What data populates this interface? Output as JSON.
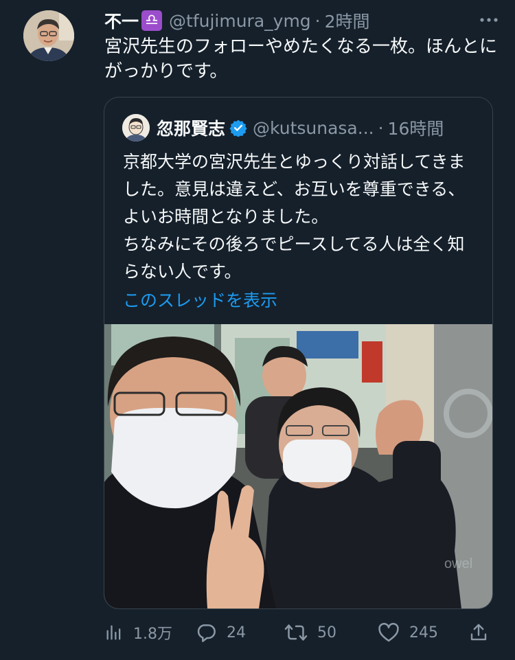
{
  "tweet": {
    "display_name": "不一",
    "zodiac_emoji": "♎",
    "handle": "@tfujimura_ymg",
    "separator": "·",
    "time": "2時間",
    "text": "宮沢先生のフォローやめたくなる一枚。ほんとにがっかりです。"
  },
  "quoted": {
    "display_name": "忽那賢志",
    "handle": "@kutsunasa...",
    "separator": "·",
    "time": "16時間",
    "text": "京都大学の宮沢先生とゆっくり対話してきました。意見は違えど、お互いを尊重できる、よいお時間となりました。\nちなみにその後ろでピースしてる人は全く知らない人です。",
    "show_thread": "このスレッドを表示"
  },
  "actions": {
    "views": "1.8万",
    "replies": "24",
    "retweets": "50",
    "likes": "245"
  },
  "colors": {
    "background": "#15202b",
    "text": "#f7f9f9",
    "secondary": "#8b98a5",
    "link": "#1d9bf0",
    "border": "#38444d"
  },
  "icons": [
    "more-icon",
    "verified-icon",
    "views-icon",
    "reply-icon",
    "retweet-icon",
    "like-icon",
    "share-icon"
  ]
}
